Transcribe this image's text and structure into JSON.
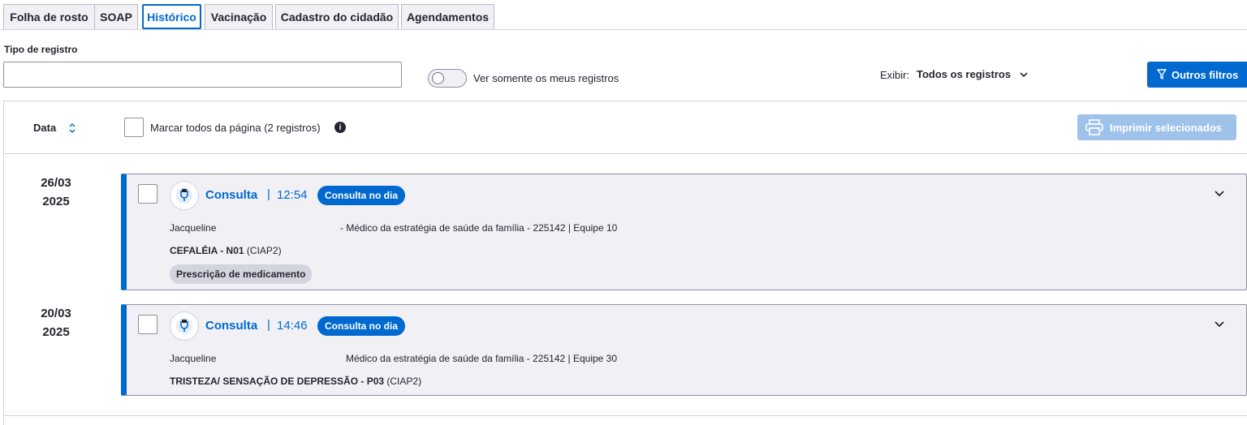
{
  "tabs": [
    {
      "label": "Folha de rosto"
    },
    {
      "label": "SOAP"
    },
    {
      "label": "Histórico"
    },
    {
      "label": "Vacinação"
    },
    {
      "label": "Cadastro do cidadão"
    },
    {
      "label": "Agendamentos"
    }
  ],
  "filters": {
    "tipo_label": "Tipo de registro",
    "tipo_value": "",
    "toggle_label": "Ver somente os meus registros",
    "exibir_label": "Exibir:",
    "exibir_value": "Todos os registros",
    "outros_filtros": "Outros filtros"
  },
  "list_header": {
    "data_label": "Data",
    "check_all_label": "Marcar todos da página (2 registros)",
    "print_label": "Imprimir selecionados"
  },
  "records": [
    {
      "date_line1": "26/03",
      "date_line2": "2025",
      "title": "Consulta",
      "sep": "|",
      "time": "12:54",
      "badge": "Consulta no dia",
      "prof_name": "Jacqueline",
      "prof_role": "- Médico da estratégia de saúde da família - 225142 | Equipe 10",
      "diag_bold": "CEFALÉIA - N01",
      "diag_code": "(CIAP2)",
      "tag": "Prescrição de medicamento"
    },
    {
      "date_line1": "20/03",
      "date_line2": "2025",
      "title": "Consulta",
      "sep": "|",
      "time": "14:46",
      "badge": "Consulta no dia",
      "prof_name": "Jacqueline",
      "prof_role": "Médico da estratégia de saúde da família - 225142 | Equipe 30",
      "diag_bold": "TRISTEZA/ SENSAÇÃO DE DEPRESSÃO - P03",
      "diag_code": "(CIAP2)"
    }
  ],
  "colors": {
    "accent": "#0069d0",
    "card_bg": "#f0f0f5",
    "disabled_button": "#9ec2ea"
  }
}
